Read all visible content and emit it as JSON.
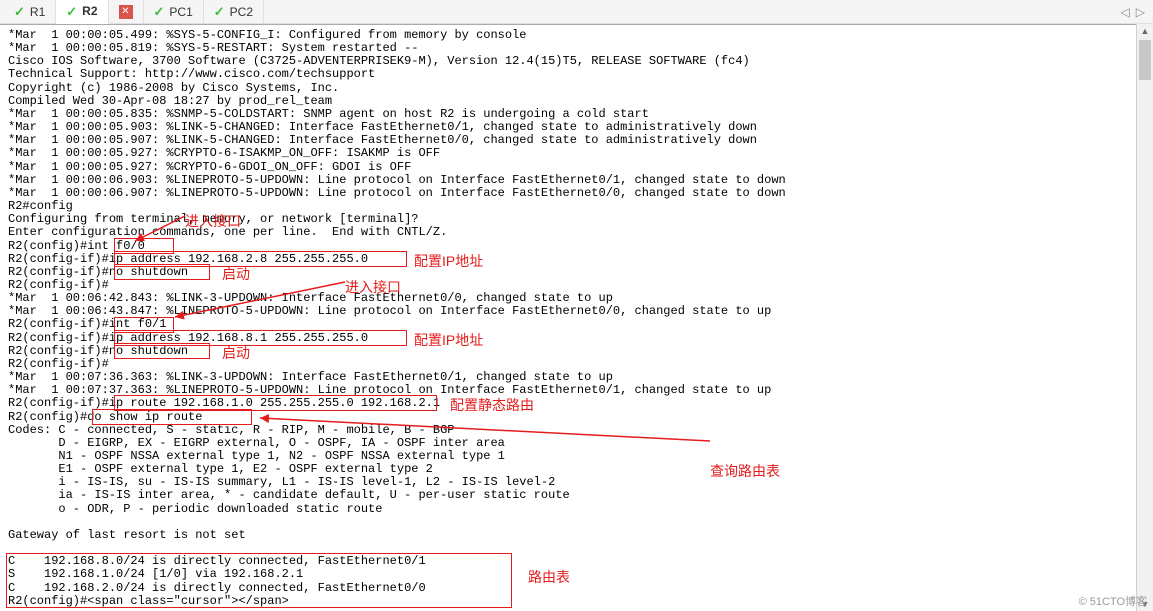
{
  "tabs": [
    {
      "icon": "check",
      "label": "R1"
    },
    {
      "icon": "check",
      "label": "R2",
      "active": true
    },
    {
      "icon": "x",
      "label": ""
    },
    {
      "icon": "check",
      "label": "PC1"
    },
    {
      "icon": "check",
      "label": "PC2"
    }
  ],
  "nav": {
    "left": "◁",
    "right": "▷"
  },
  "terminal_lines": [
    "*Mar  1 00:00:05.499: %SYS-5-CONFIG_I: Configured from memory by console",
    "*Mar  1 00:00:05.819: %SYS-5-RESTART: System restarted --",
    "Cisco IOS Software, 3700 Software (C3725-ADVENTERPRISEK9-M), Version 12.4(15)T5, RELEASE SOFTWARE (fc4)",
    "Technical Support: http://www.cisco.com/techsupport",
    "Copyright (c) 1986-2008 by Cisco Systems, Inc.",
    "Compiled Wed 30-Apr-08 18:27 by prod_rel_team",
    "*Mar  1 00:00:05.835: %SNMP-5-COLDSTART: SNMP agent on host R2 is undergoing a cold start",
    "*Mar  1 00:00:05.903: %LINK-5-CHANGED: Interface FastEthernet0/1, changed state to administratively down",
    "*Mar  1 00:00:05.907: %LINK-5-CHANGED: Interface FastEthernet0/0, changed state to administratively down",
    "*Mar  1 00:00:05.927: %CRYPTO-6-ISAKMP_ON_OFF: ISAKMP is OFF",
    "*Mar  1 00:00:05.927: %CRYPTO-6-GDOI_ON_OFF: GDOI is OFF",
    "*Mar  1 00:00:06.903: %LINEPROTO-5-UPDOWN: Line protocol on Interface FastEthernet0/1, changed state to down",
    "*Mar  1 00:00:06.907: %LINEPROTO-5-UPDOWN: Line protocol on Interface FastEthernet0/0, changed state to down",
    "R2#config",
    "Configuring from terminal, memory, or network [terminal]?",
    "Enter configuration commands, one per line.  End with CNTL/Z.",
    "R2(config)#int f0/0",
    "R2(config-if)#ip address 192.168.2.8 255.255.255.0",
    "R2(config-if)#no shutdown",
    "R2(config-if)#",
    "*Mar  1 00:06:42.843: %LINK-3-UPDOWN: Interface FastEthernet0/0, changed state to up",
    "*Mar  1 00:06:43.847: %LINEPROTO-5-UPDOWN: Line protocol on Interface FastEthernet0/0, changed state to up",
    "R2(config-if)#int f0/1",
    "R2(config-if)#ip address 192.168.8.1 255.255.255.0",
    "R2(config-if)#no shutdown",
    "R2(config-if)#",
    "*Mar  1 00:07:36.363: %LINK-3-UPDOWN: Interface FastEthernet0/1, changed state to up",
    "*Mar  1 00:07:37.363: %LINEPROTO-5-UPDOWN: Line protocol on Interface FastEthernet0/1, changed state to up",
    "R2(config-if)#ip route 192.168.1.0 255.255.255.0 192.168.2.1",
    "R2(config)#do show ip route",
    "Codes: C - connected, S - static, R - RIP, M - mobile, B - BGP",
    "       D - EIGRP, EX - EIGRP external, O - OSPF, IA - OSPF inter area",
    "       N1 - OSPF NSSA external type 1, N2 - OSPF NSSA external type 1",
    "       E1 - OSPF external type 1, E2 - OSPF external type 2",
    "       i - IS-IS, su - IS-IS summary, L1 - IS-IS level-1, L2 - IS-IS level-2",
    "       ia - IS-IS inter area, * - candidate default, U - per-user static route",
    "       o - ODR, P - periodic downloaded static route",
    "",
    "Gateway of last resort is not set",
    "",
    "C    192.168.8.0/24 is directly connected, FastEthernet0/1",
    "S    192.168.1.0/24 [1/0] via 192.168.2.1",
    "C    192.168.2.0/24 is directly connected, FastEthernet0/0",
    "R2(config)#"
  ],
  "annotations": {
    "enter_if_1": "进入接口",
    "cfg_ip_1": "配置IP地址",
    "startup_1": "启动",
    "enter_if_2": "进入接口",
    "cfg_ip_2": "配置IP地址",
    "startup_2": "启动",
    "cfg_static": "配置静态路由",
    "show_route": "查询路由表",
    "route_table": "路由表"
  },
  "watermark": "© 51CTO博客"
}
